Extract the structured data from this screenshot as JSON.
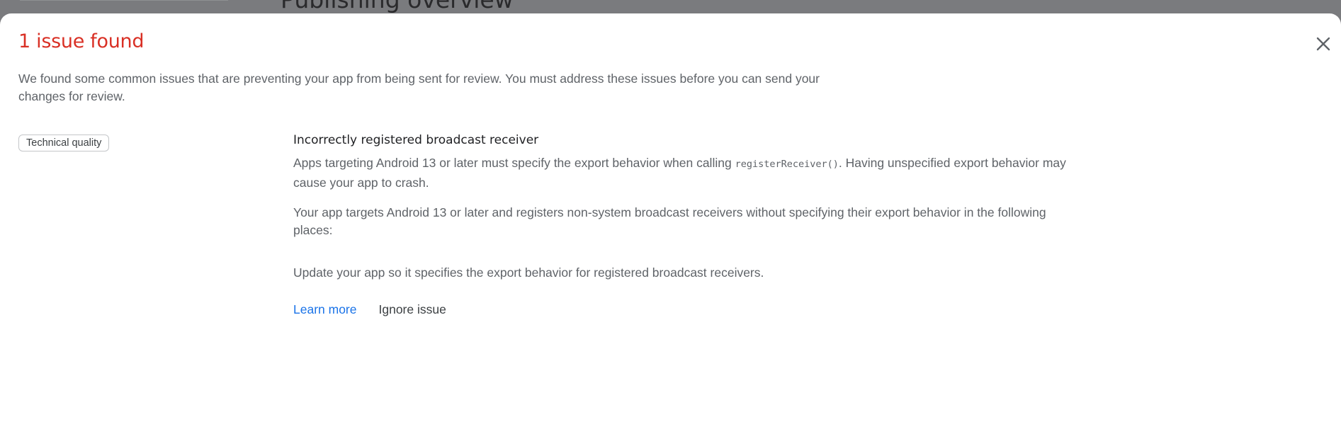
{
  "background": {
    "page_title": "Publishing overview"
  },
  "dialog": {
    "title": "1 issue found",
    "title_color": "#d93025",
    "close_icon": "close-icon",
    "intro": "We found some common issues that are preventing your app from being sent for review. You must address these issues before you can send your changes for review.",
    "category_chip": "Technical quality",
    "issue": {
      "title": "Incorrectly registered broadcast receiver",
      "description_before": "Apps targeting Android 13 or later must specify the export behavior when calling ",
      "code": "registerReceiver()",
      "description_after": ". Having unspecified export behavior may cause your app to crash.",
      "detail": "Your app targets Android 13 or later and registers non-system broadcast receivers without specifying their export behavior in the following places:",
      "fix": "Update your app so it specifies the export behavior for registered broadcast receivers.",
      "learn_more_label": "Learn more",
      "ignore_label": "Ignore issue"
    }
  }
}
